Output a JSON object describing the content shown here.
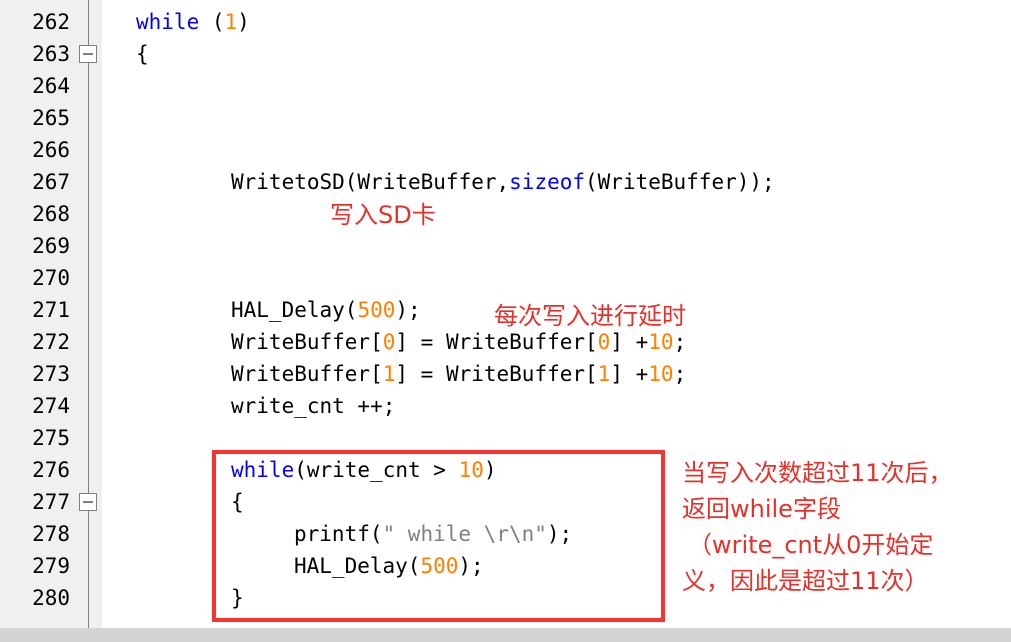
{
  "lines": [
    "262",
    "263",
    "264",
    "265",
    "266",
    "267",
    "268",
    "269",
    "270",
    "271",
    "272",
    "273",
    "274",
    "275",
    "276",
    "277",
    "278",
    "279",
    "280"
  ],
  "code": {
    "l262_kw": "while",
    "l262_rest": " (",
    "l262_num": "1",
    "l262_close": ")",
    "l263": "{",
    "l267_a": "WritetoSD(WriteBuffer,",
    "l267_kw": "sizeof",
    "l267_b": "(WriteBuffer));",
    "l271_a": "HAL_Delay(",
    "l271_num": "500",
    "l271_b": ");",
    "l272_a": "WriteBuffer[",
    "l272_n1": "0",
    "l272_b": "] = WriteBuffer[",
    "l272_n2": "0",
    "l272_c": "] +",
    "l272_n3": "10",
    "l272_d": ";",
    "l273_a": "WriteBuffer[",
    "l273_n1": "1",
    "l273_b": "] = WriteBuffer[",
    "l273_n2": "1",
    "l273_c": "] +",
    "l273_n3": "10",
    "l273_d": ";",
    "l274": "write_cnt ++;",
    "l276_kw": "while",
    "l276_a": "(write_cnt > ",
    "l276_num": "10",
    "l276_b": ")",
    "l277": "{",
    "l278_a": "printf(",
    "l278_str": "\" while \\r\\n\"",
    "l278_b": ");",
    "l279_a": "HAL_Delay(",
    "l279_num": "500",
    "l279_b": ");",
    "l280": "}"
  },
  "annotations": {
    "write_sd": "写入SD卡",
    "delay": "每次写入进行延时",
    "cond_1": "当写入次数超过11次后，",
    "cond_2": "返回while字段",
    "cond_3": "（write_cnt从0开始定",
    "cond_4": "义，因此是超过11次）"
  },
  "colors": {
    "keyword": "#0000ff",
    "number": "#ff8000",
    "string": "#808080",
    "annotation": "#e8302a",
    "highlight_box": "#ff3030"
  }
}
